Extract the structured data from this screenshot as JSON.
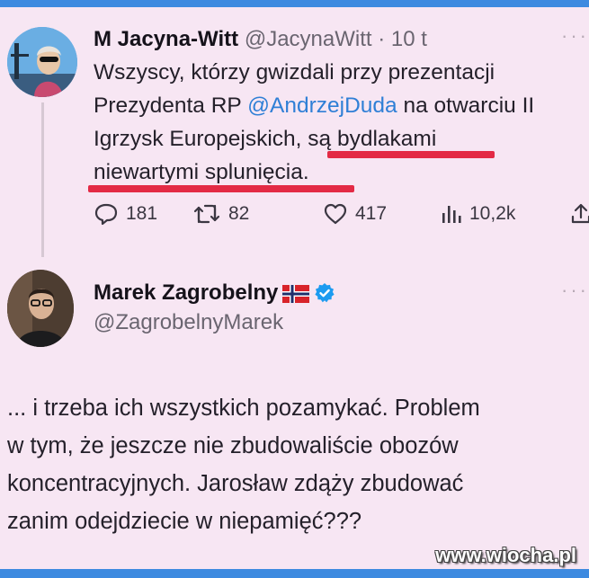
{
  "tweet1": {
    "author_name": "M Jacyna-Witt",
    "author_handle": "@JacynaWitt",
    "separator": "·",
    "time": "10 t",
    "text_lines": [
      {
        "before": "Wszyscy, którzy gwizdali przy prezentacji",
        "mention": "",
        "after": ""
      },
      {
        "before": "Prezydenta RP ",
        "mention": "@AndrzejDuda",
        "after": " na otwarciu II"
      },
      {
        "before": "Igrzysk Europejskich, są bydlakami",
        "mention": "",
        "after": ""
      },
      {
        "before": "niewartymi splunięcia.",
        "mention": "",
        "after": ""
      }
    ],
    "stats": {
      "replies": "181",
      "retweets": "82",
      "likes": "417",
      "views": "10,2k"
    }
  },
  "tweet2": {
    "author_name": "Marek Zagrobelny",
    "author_handle": "@ZagrobelnyMarek",
    "text_lines": [
      "... i trzeba ich wszystkich pozamykać. Problem",
      "w tym, że jeszcze nie zbudowaliście obozów",
      "koncentracyjnych. Jarosław zdąży zbudować",
      "zanim odejdziecie w niepamięć???"
    ]
  },
  "watermark": "www.wiocha.pl",
  "colors": {
    "background": "#f7e6f3",
    "frame_blue": "#3d8ae0",
    "mention_blue": "#2f7fd6",
    "underline_red": "#e32a45",
    "verified_blue": "#1d9bf0"
  },
  "icons": [
    "reply-icon",
    "retweet-icon",
    "like-icon",
    "views-icon",
    "share-icon",
    "verified-badge-icon",
    "norway-flag-icon",
    "more-options-icon"
  ]
}
